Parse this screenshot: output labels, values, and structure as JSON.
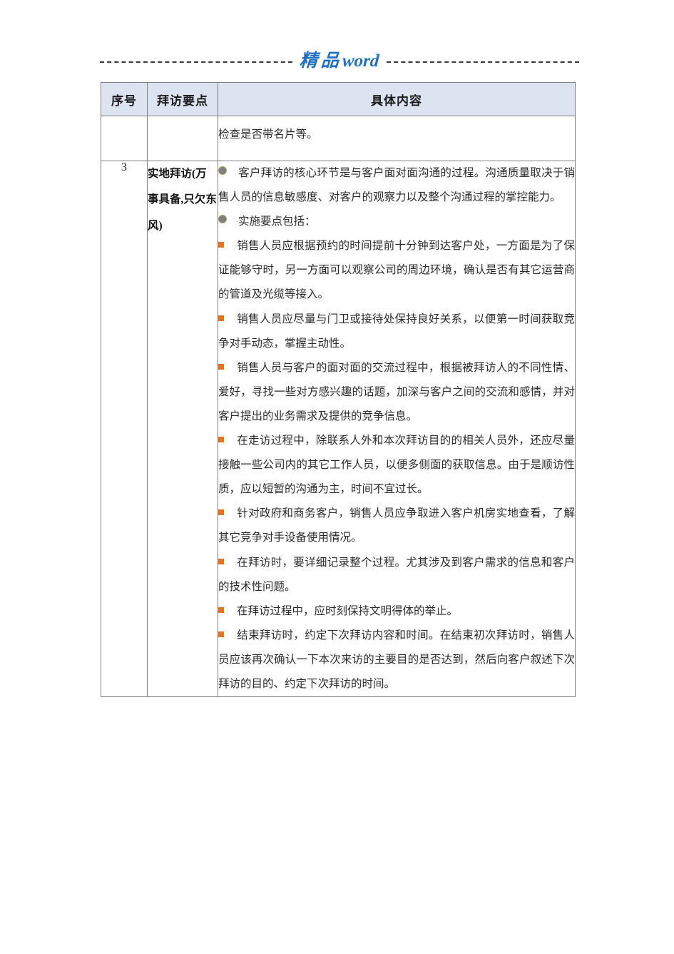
{
  "header": {
    "brand_cn": "精品",
    "brand_en": "word"
  },
  "table": {
    "columns": [
      "序号",
      "拜访要点",
      "具体内容"
    ],
    "rows": [
      {
        "seq": "",
        "key_point": "",
        "content": [
          {
            "marker": "none",
            "text": "检查是否带名片等。"
          }
        ]
      },
      {
        "seq": "3",
        "key_point": "实地拜访(万事具备,只欠东风)",
        "content": [
          {
            "marker": "disc",
            "text": "客户拜访的核心环节是与客户面对面沟通的过程。沟通质量取决于销售人员的信息敏感度、对客户的观察力以及整个沟通过程的掌控能力。"
          },
          {
            "marker": "disc",
            "text": "实施要点包括："
          },
          {
            "marker": "square",
            "text": "销售人员应根据预约的时间提前十分钟到达客户处，一方面是为了保证能够守时，另一方面可以观察公司的周边环境，确认是否有其它运营商的管道及光缆等接入。"
          },
          {
            "marker": "square",
            "text": "销售人员应尽量与门卫或接待处保持良好关系，以便第一时间获取竞争对手动态，掌握主动性。"
          },
          {
            "marker": "square",
            "text": "销售人员与客户的面对面的交流过程中，根据被拜访人的不同性情、爱好，寻找一些对方感兴趣的话题，加深与客户之间的交流和感情，并对客户提出的业务需求及提供的竞争信息。"
          },
          {
            "marker": "square",
            "text": "在走访过程中，除联系人外和本次拜访目的的相关人员外，还应尽量接触一些公司内的其它工作人员，以便多侧面的获取信息。由于是顺访性质，应以短暂的沟通为主，时间不宜过长。"
          },
          {
            "marker": "square",
            "text": "针对政府和商务客户，销售人员应争取进入客户机房实地查看，了解其它竞争对手设备使用情况。"
          },
          {
            "marker": "square",
            "text": "在拜访时，要详细记录整个过程。尤其涉及到客户需求的信息和客户的技术性问题。"
          },
          {
            "marker": "square",
            "text": "在拜访过程中，应时刻保持文明得体的举止。"
          },
          {
            "marker": "square",
            "text": "结束拜访时，约定下次拜访内容和时间。在结束初次拜访时，销售人员应该再次确认一下本次来访的主要目的是否达到，然后向客户叙述下次拜访的目的、约定下次拜访的时间。"
          }
        ]
      }
    ]
  },
  "colors": {
    "brand": "#1F6FC4",
    "header_bg": "#dce4f2",
    "border": "#7f7f7f",
    "disc_bullet": "#7f7f7f",
    "square_bullet": "#E8721C"
  }
}
